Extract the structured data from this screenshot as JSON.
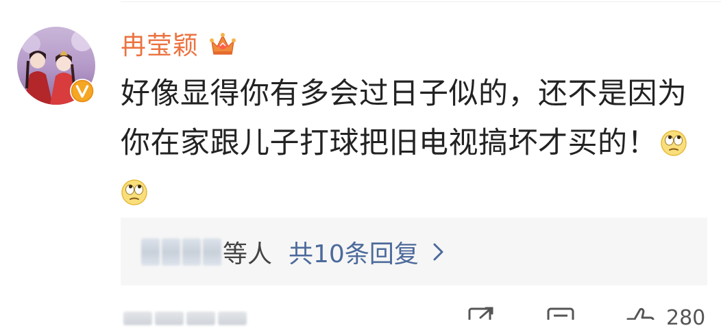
{
  "comment": {
    "username": "冉莹颖",
    "text": "好像显得你有多会过日子似的，还不是因为你在家跟儿子打球把旧电视搞坏才买的！",
    "emojis": [
      "rolleyes-emoji",
      "rolleyes-emoji"
    ],
    "badges": [
      "crown-vip-icon",
      "verified-v-badge"
    ]
  },
  "replies": {
    "others_label": "等人",
    "count_label": "共10条回复"
  },
  "actions": {
    "like_count": "280"
  },
  "colors": {
    "username": "#eb7340",
    "reply_link": "#4c6a9b",
    "reply_box_bg": "#f6f6f6",
    "text": "#222222"
  }
}
